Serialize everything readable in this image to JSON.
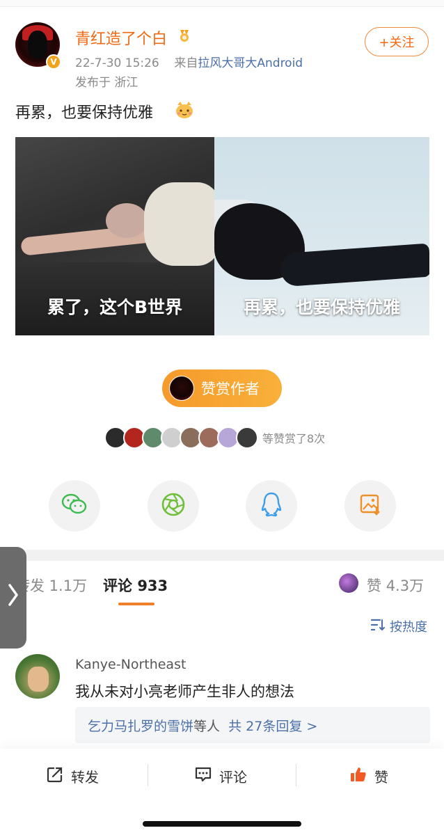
{
  "post": {
    "author": {
      "name": "青红造了个白",
      "verified_badge": "V",
      "medal_icon": "medal-icon"
    },
    "time": "22-7-30 15:26",
    "source_prefix": "来自",
    "source_device": "拉风大哥大Android",
    "location": "发布于 浙江",
    "follow_label": "+关注",
    "text": "再累，也要保持优雅",
    "emoji_icon": "cat-emoji-icon",
    "images": [
      {
        "caption": "累了，这个B世界"
      },
      {
        "caption": "再累，也要保持优雅"
      }
    ]
  },
  "reward": {
    "button_label": "赞赏作者",
    "summary": "等赞赏了8次",
    "supporter_colors": [
      "#2b2b2b",
      "#b3261e",
      "#5f8a6b",
      "#cfcfcf",
      "#8b6d5c",
      "#9c6b5c",
      "#b7a7d9",
      "#3a3a3a"
    ]
  },
  "share": {
    "icons": [
      "wechat-icon",
      "moments-icon",
      "qq-icon",
      "save-image-icon"
    ],
    "colors": {
      "wechat": "#3fba51",
      "moments": "#6fbf3b",
      "qq": "#3f9ee8",
      "save": "#f0902a"
    }
  },
  "tabs": {
    "repost": "转发 1.1万",
    "comments_label": "评论",
    "comments_count": "933",
    "likes_label": "赞",
    "likes_count": "4.3万"
  },
  "sort": {
    "label": "按热度"
  },
  "comment": {
    "user": "Kanye-Northeast",
    "text": "我从未对小亮老师产生非人的想法",
    "reply_user": "乞力马扎罗的雪饼",
    "reply_suffix": "等人",
    "reply_count": "共 27条回复 >"
  },
  "bottom_bar": {
    "repost": "转发",
    "comment": "评论",
    "like": "赞"
  },
  "colors": {
    "accent": "#f06a13",
    "link": "#4b6fa8",
    "reward_gradient_start": "#f59a2c",
    "reward_gradient_end": "#f9b03a"
  }
}
